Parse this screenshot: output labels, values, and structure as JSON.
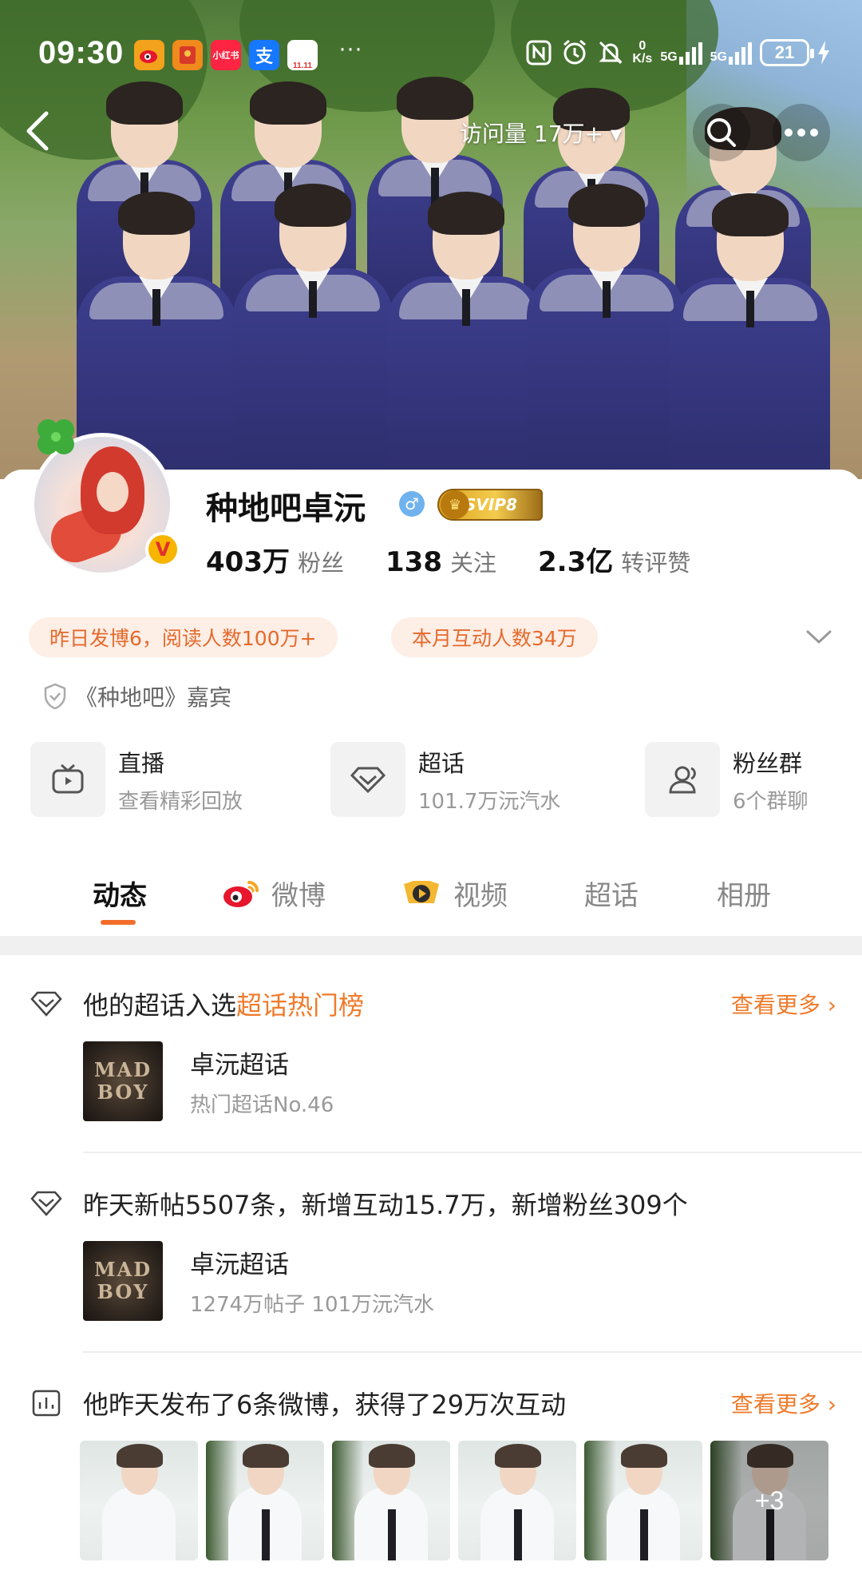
{
  "status_bar": {
    "time": "09:30",
    "app_icons": [
      {
        "name": "weibo-icon",
        "color": "#f3a21b",
        "label": ""
      },
      {
        "name": "red-packet-icon",
        "color": "#f08a1c",
        "label": ""
      },
      {
        "name": "xiaohongshu-icon",
        "color": "#ff2442",
        "label": "小红书"
      },
      {
        "name": "alipay-icon",
        "color": "#1677ff",
        "label": "支"
      },
      {
        "name": "taobao-1111-icon",
        "color": "#e02e2e",
        "label": "11.11"
      }
    ],
    "more": "···",
    "net_speed_top": "0",
    "net_speed_unit": "K/s",
    "signal_1": "5G",
    "signal_2": "5G",
    "battery": "21"
  },
  "nav": {
    "visits": "访问量 17万+ ▾"
  },
  "profile": {
    "name": "种地吧卓沅",
    "vip_label": "SVIP8",
    "vip_crown": "♛",
    "verify_badge": "V",
    "gender_symbol": "♂",
    "stats": [
      {
        "value": "403万",
        "label": "粉丝"
      },
      {
        "value": "138",
        "label": "关注"
      },
      {
        "value": "2.3亿",
        "label": "转评赞"
      }
    ],
    "pills": [
      "昨日发博6，阅读人数100万+",
      "本月互动人数34万"
    ],
    "guest_text": "《种地吧》嘉宾"
  },
  "shortcuts": [
    {
      "title": "直播",
      "subtitle": "查看精彩回放"
    },
    {
      "title": "超话",
      "subtitle": "101.7万沅汽水"
    },
    {
      "title": "粉丝群",
      "subtitle": "6个群聊"
    }
  ],
  "tabs": [
    "动态",
    "微博",
    "视频",
    "超话",
    "相册"
  ],
  "feed": {
    "section1": {
      "text_prefix": "他的超话入选",
      "text_highlight": "超话热门榜",
      "more": "查看更多",
      "topic_name": "卓沅超话",
      "topic_sub": "热门超话No.46",
      "thumb_line1": "MAD",
      "thumb_line2": "BOY"
    },
    "section2": {
      "text": "昨天新帖5507条，新增互动15.7万，新增粉丝309个",
      "topic_name": "卓沅超话",
      "topic_sub": "1274万帖子 101万沅汽水",
      "thumb_line1": "MAD",
      "thumb_line2": "BOY"
    },
    "section3": {
      "text": "他昨天发布了6条微博，获得了29万次互动",
      "more": "查看更多",
      "more_photos": "+3"
    }
  },
  "colors": {
    "accent": "#f26d2a",
    "pill_bg": "#fdeee6",
    "pill_text": "#e56a2c"
  }
}
